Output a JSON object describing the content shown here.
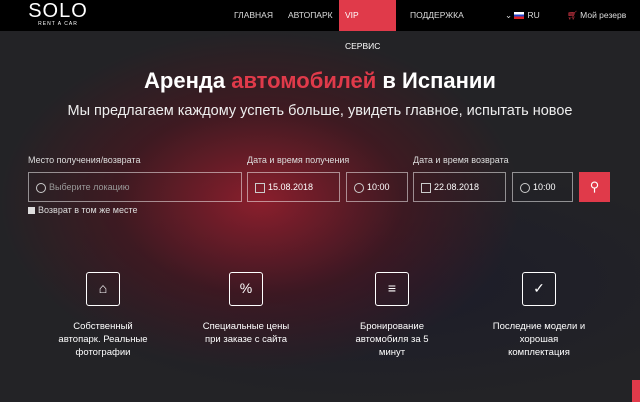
{
  "header": {
    "logo": "SOLO",
    "logo_sub": "RENT A CAR",
    "nav": [
      "ГЛАВНАЯ",
      "АВТОПАРК",
      "VIP СЕРВИС",
      "ПОДДЕРЖКА"
    ],
    "lang": "RU",
    "cart": "Мой резерв"
  },
  "hero": {
    "title_1": "Аренда ",
    "title_red": "автомобилей",
    "title_2": " в Испании",
    "subtitle": "Мы предлагаем каждому успеть больше, увидеть главное, испытать новое"
  },
  "form": {
    "location_label": "Место получения/возврата",
    "location_placeholder": "Выберите локацию",
    "pickup_label": "Дата и время получения",
    "pickup_date": "15.08.2018",
    "pickup_time": "10:00",
    "return_label": "Дата и время возврата",
    "return_date": "22.08.2018",
    "return_time": "10:00",
    "same_place": "Возврат в том же месте"
  },
  "features": [
    {
      "line1": "Собственный",
      "line2": "автопарк. Реальные",
      "line3": "фотографии"
    },
    {
      "line1": "Специальные цены",
      "line2": "при заказе с сайта",
      "line3": ""
    },
    {
      "line1": "Бронирование",
      "line2": "автомобиля за 5",
      "line3": "минут"
    },
    {
      "line1": "Последние модели и",
      "line2": "хорошая",
      "line3": "комплектация"
    }
  ],
  "colors": {
    "accent": "#e03a4a"
  }
}
